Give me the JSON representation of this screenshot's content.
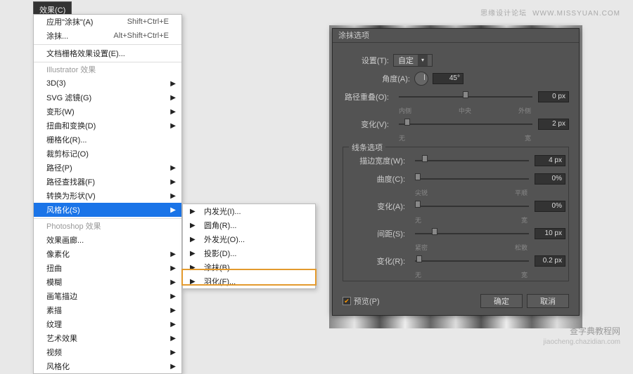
{
  "watermark": {
    "top": "思缘设计论坛",
    "top_url": "WWW.MISSYUAN.COM",
    "bottom_cn": "查字典教程网",
    "bottom_py": "jiaocheng.chazidian.com"
  },
  "menubar": {
    "effects": "效果(C)"
  },
  "menu": {
    "apply": "应用\"涂抹\"(A)",
    "apply_sc": "Shift+Ctrl+E",
    "smear": "涂抹...",
    "smear_sc": "Alt+Shift+Ctrl+E",
    "doc_raster": "文档栅格效果设置(E)...",
    "header_ai": "Illustrator 效果",
    "items_ai": [
      "3D(3)",
      "SVG 滤镜(G)",
      "变形(W)",
      "扭曲和变换(D)",
      "栅格化(R)...",
      "裁剪标记(O)",
      "路径(P)",
      "路径查找器(F)",
      "转换为形状(V)",
      "风格化(S)"
    ],
    "header_ps": "Photoshop 效果",
    "items_ps": [
      "效果画廊...",
      "像素化",
      "扭曲",
      "模糊",
      "画笔描边",
      "素描",
      "纹理",
      "艺术效果",
      "视频",
      "风格化"
    ]
  },
  "submenu": {
    "items": [
      "内发光(I)...",
      "圆角(R)...",
      "外发光(O)...",
      "投影(D)...",
      "涂抹(B)...",
      "羽化(F)..."
    ]
  },
  "dialog": {
    "title": "涂抹选项",
    "preset_label": "设置(T):",
    "preset_value": "自定",
    "angle_label": "角度(A):",
    "angle_value": "45°",
    "overlap_label": "路径重叠(O):",
    "overlap_value": "0 px",
    "overlap_ticks": [
      "内侧",
      "中央",
      "外侧"
    ],
    "var1_label": "变化(V):",
    "var1_value": "2 px",
    "var1_ticks": [
      "无",
      "宽"
    ],
    "line_legend": "线条选项",
    "width_label": "描边宽度(W):",
    "width_value": "4 px",
    "curve_label": "曲度(C):",
    "curve_value": "0%",
    "curve_ticks": [
      "尖锐",
      "平顺"
    ],
    "var2_label": "变化(A):",
    "var2_value": "0%",
    "var2_ticks": [
      "无",
      "宽"
    ],
    "spacing_label": "间距(S):",
    "spacing_value": "10 px",
    "spacing_ticks": [
      "紧密",
      "松散"
    ],
    "var3_label": "变化(R):",
    "var3_value": "0.2 px",
    "var3_ticks": [
      "无",
      "宽"
    ],
    "preview": "预览(P)",
    "ok": "确定",
    "cancel": "取消"
  }
}
